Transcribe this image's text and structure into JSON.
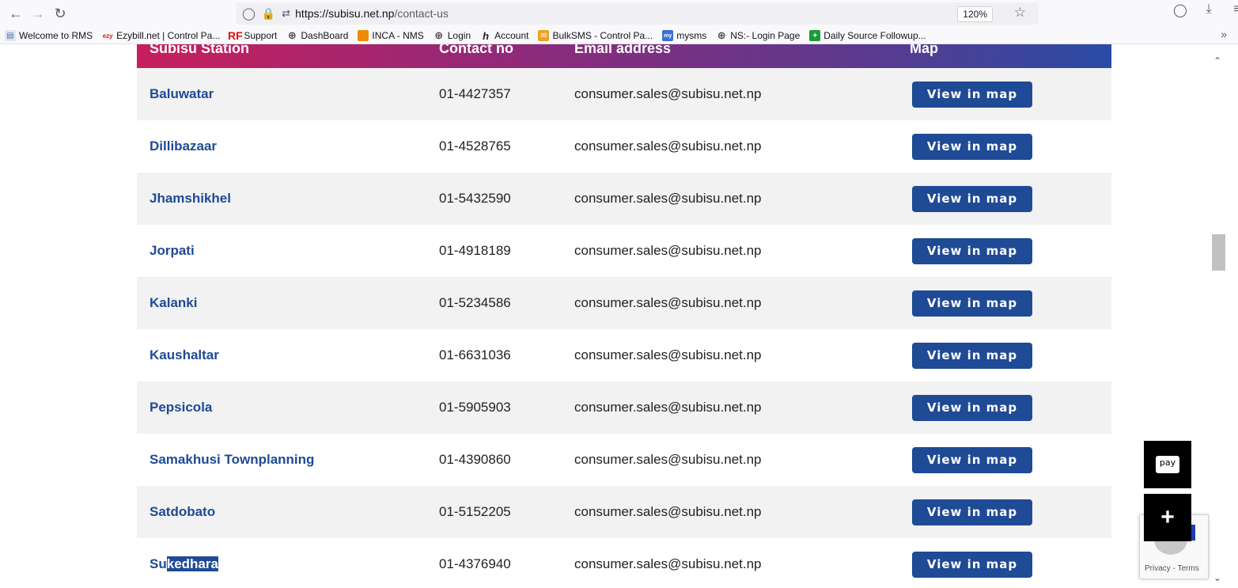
{
  "browser": {
    "url_main": "https://subisu.net.np",
    "url_path": "/contact-us",
    "zoom": "120%"
  },
  "bookmarks": [
    {
      "label": "Welcome to RMS",
      "icon": "document-icon"
    },
    {
      "label": "Ezybill.net | Control Pa...",
      "icon": "ezybill-icon"
    },
    {
      "label": "Support",
      "icon": "rf-icon"
    },
    {
      "label": "DashBoard",
      "icon": "globe-icon"
    },
    {
      "label": "INCA - NMS",
      "icon": "orange-square-icon"
    },
    {
      "label": "Login",
      "icon": "globe-icon"
    },
    {
      "label": "Account",
      "icon": "h-icon"
    },
    {
      "label": "BulkSMS - Control Pa...",
      "icon": "mail-icon"
    },
    {
      "label": "mysms",
      "icon": "mysms-icon"
    },
    {
      "label": "NS:- Login Page",
      "icon": "globe-icon"
    },
    {
      "label": "Daily Source Followup...",
      "icon": "plus-green-icon"
    }
  ],
  "table": {
    "headers": [
      "Subisu Station",
      "Contact no",
      "Email address",
      "Map"
    ],
    "rows": [
      {
        "station": "Baluwatar",
        "phone": "01-4427357",
        "email": "consumer.sales@subisu.net.np",
        "map": "View in map"
      },
      {
        "station": "Dillibazaar",
        "phone": "01-4528765",
        "email": "consumer.sales@subisu.net.np",
        "map": "View in map"
      },
      {
        "station": "Jhamshikhel",
        "phone": "01-5432590",
        "email": "consumer.sales@subisu.net.np",
        "map": "View in map"
      },
      {
        "station": "Jorpati",
        "phone": "01-4918189",
        "email": "consumer.sales@subisu.net.np",
        "map": "View in map"
      },
      {
        "station": "Kalanki",
        "phone": "01-5234586",
        "email": "consumer.sales@subisu.net.np",
        "map": "View in map"
      },
      {
        "station": "Kaushaltar",
        "phone": "01-6631036",
        "email": "consumer.sales@subisu.net.np",
        "map": "View in map"
      },
      {
        "station": "Pepsicola",
        "phone": "01-5905903",
        "email": "consumer.sales@subisu.net.np",
        "map": "View in map"
      },
      {
        "station": "Samakhusi Townplanning",
        "phone": "01-4390860",
        "email": "consumer.sales@subisu.net.np",
        "map": "View in map"
      },
      {
        "station": "Satdobato",
        "phone": "01-5152205",
        "email": "consumer.sales@subisu.net.np",
        "map": "View in map"
      },
      {
        "station_prefix": "Su",
        "station_selected": "kedhara",
        "phone": "01-4376940",
        "email": "consumer.sales@subisu.net.np",
        "map": "View in map"
      }
    ]
  },
  "widgets": {
    "pay_label": "pay",
    "recaptcha_terms": "Privacy - Terms"
  },
  "colors": {
    "accent": "#1f4a96",
    "header_gradient_start": "#c71f5d",
    "header_gradient_end": "#2a4ca6"
  }
}
